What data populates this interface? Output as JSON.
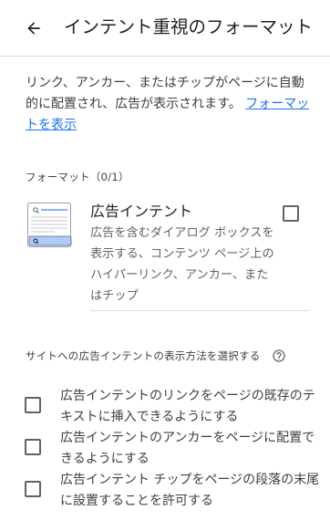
{
  "header": {
    "title": "インテント重視のフォーマット"
  },
  "description": {
    "text": "リンク、アンカー、またはチップがページに自動的に配置され、広告が表示されます。",
    "link_label": "フォーマットを表示"
  },
  "formats": {
    "count_label": "フォーマット（0/1）",
    "items": [
      {
        "title": "広告インテント",
        "description": "広告を含むダイアログ ボックスを表示する、コンテンツ ページ上のハイパーリンク、アンカー、またはチップ",
        "checked": false
      }
    ]
  },
  "display_method": {
    "label": "サイトへの広告インテントの表示方法を選択する",
    "options": [
      {
        "label": "広告インテントのリンクをページの既存のテキストに挿入できるようにする",
        "checked": false
      },
      {
        "label": "広告インテントのアンカーをページに配置できるようにする",
        "checked": false
      },
      {
        "label": "広告インテント チップをページの段落の末尾に設置することを許可する",
        "checked": false
      }
    ]
  },
  "icons": {
    "back": "arrow-back-icon",
    "help": "help-circle-icon",
    "thumbnail": "ad-intent-thumbnail-icon"
  },
  "colors": {
    "link": "#1a73e8",
    "text": "#202124",
    "secondary_text": "#5f6368",
    "divider": "#dadce0",
    "thumbnail_accent": "#8ab4f8"
  }
}
